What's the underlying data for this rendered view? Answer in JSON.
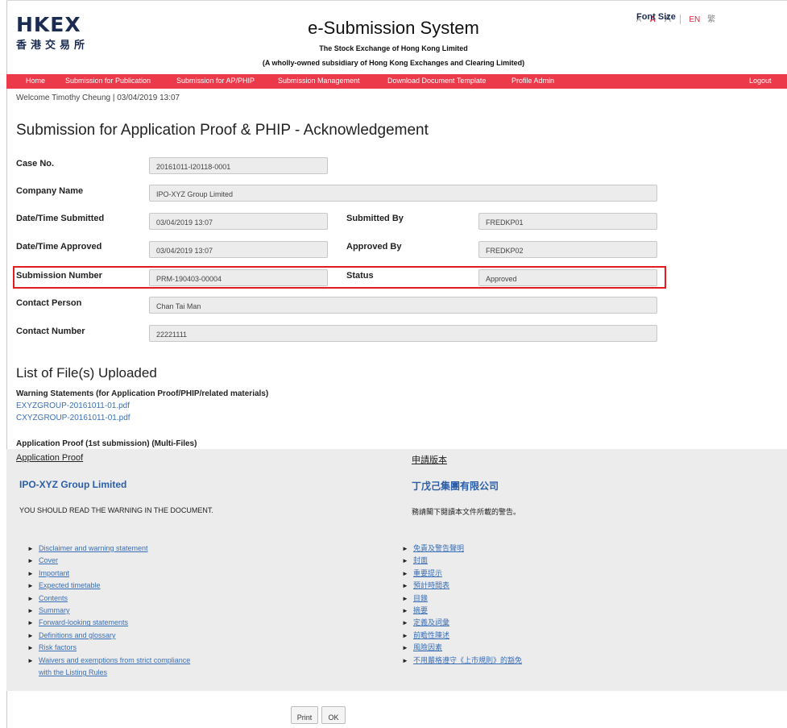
{
  "header": {
    "logo_en": "HKEX",
    "logo_zh": "香港交易所",
    "system_title": "e-Submission System",
    "subtitle1": "The Stock Exchange of Hong Kong Limited",
    "subtitle2": "(A wholly-owned subsidiary of Hong Kong Exchanges and Clearing Limited)",
    "font_size_label": "Font Size",
    "font_small": "A",
    "font_medium": "A",
    "font_large": "A",
    "lang_en": "EN",
    "lang_zh": "繁"
  },
  "nav": {
    "items": [
      "Home",
      "Submission for Publication",
      "Submission for AP/PHIP",
      "Submission Management",
      "Download Document Template",
      "Profile Admin"
    ],
    "logout": "Logout"
  },
  "welcome": "Welcome Timothy Cheung | 03/04/2019 13:07",
  "page_title": "Submission for Application Proof & PHIP - Acknowledgement",
  "form": {
    "case_no_label": "Case No.",
    "case_no": "20161011-I20118-0001",
    "company_name_label": "Company Name",
    "company_name": "IPO-XYZ Group Limited",
    "submitted_label": "Date/Time Submitted",
    "submitted": "03/04/2019 13:07",
    "submitted_by_label": "Submitted By",
    "submitted_by": "FREDKP01",
    "approved_label": "Date/Time Approved",
    "approved": "03/04/2019 13:07",
    "approved_by_label": "Approved By",
    "approved_by": "FREDKP02",
    "submission_number_label": "Submission Number",
    "submission_number": "PRM-190403-00004",
    "status_label": "Status",
    "status": "Approved",
    "contact_person_label": "Contact Person",
    "contact_person": "Chan Tai Man",
    "contact_number_label": "Contact Number",
    "contact_number": "22221111"
  },
  "files": {
    "section_title": "List of File(s) Uploaded",
    "warning_heading": "Warning Statements (for Application Proof/PHIP/related materials)",
    "warning_files": [
      "EXYZGROUP-20161011-01.pdf",
      "CXYZGROUP-20161011-01.pdf"
    ],
    "proof_heading": "Application Proof (1st submission) (Multi-Files)"
  },
  "proof": {
    "en": {
      "header": "Application Proof",
      "company": "IPO-XYZ Group Limited",
      "warning": "YOU SHOULD READ THE WARNING IN THE DOCUMENT.",
      "items": [
        "Disclaimer and warning statement",
        "Cover",
        "Important",
        "Expected timetable",
        "Contents",
        "Summary",
        "Forward-looking statements",
        "Definitions and glossary",
        "Risk factors",
        "Waivers and exemptions from strict compliance"
      ],
      "last_item_cont": "with the Listing Rules"
    },
    "zh": {
      "header": "申請版本",
      "company": "丁戊己集團有限公司",
      "warning": "務請閣下閱讀本文件所載的警告。",
      "items": [
        "免責及警告聲明",
        "封面",
        "重要提示",
        "預計時間表",
        "目錄",
        "摘要",
        "定義及詞彙",
        "前瞻性陳述",
        "風險因素",
        "不用嚴格遵守《上市規則》的豁免"
      ]
    },
    "arrow": "►"
  },
  "buttons": {
    "print": "Print",
    "ok": "OK"
  }
}
